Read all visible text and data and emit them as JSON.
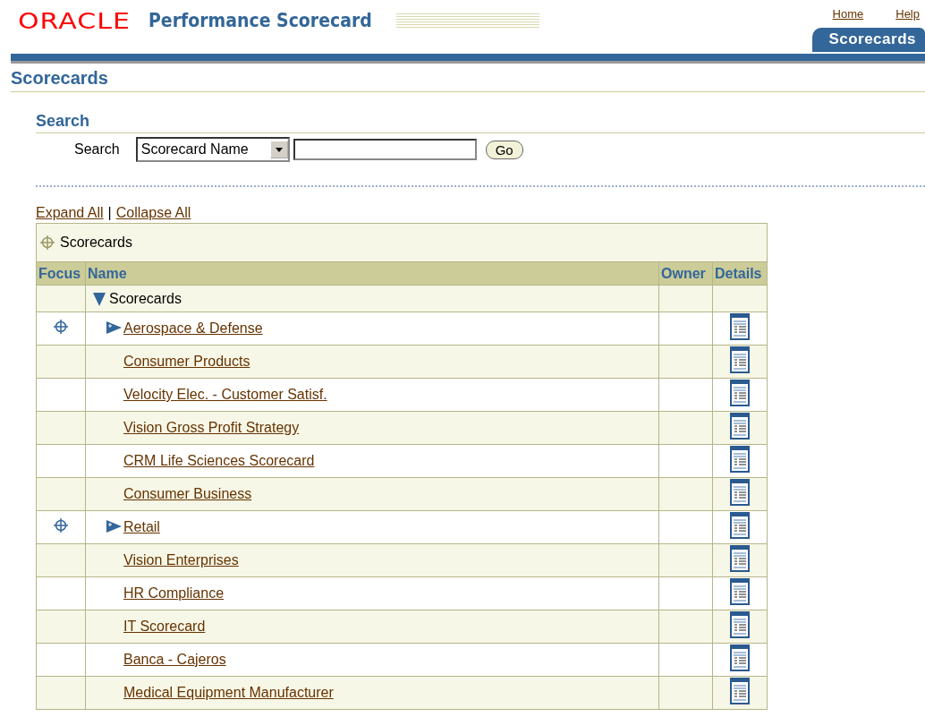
{
  "header": {
    "logo": "ORACLE",
    "product": "Performance Scorecard",
    "links": [
      "Home",
      "Help"
    ],
    "tabs": [
      {
        "label": "Scorecards",
        "selected": true
      }
    ]
  },
  "page_title": "Scorecards",
  "search": {
    "heading": "Search",
    "label": "Search",
    "select_value": "Scorecard Name",
    "button": "Go"
  },
  "tree_links": {
    "expand": "Expand All",
    "separator": "|",
    "collapse": "Collapse All"
  },
  "table": {
    "focus_caption": "Scorecards",
    "columns": [
      "Focus",
      "Name",
      "Owner",
      "Details"
    ],
    "root": {
      "name": "Scorecards",
      "expanded": true,
      "children": [
        {
          "name": "Aerospace & Defense",
          "focus": true,
          "expanded": false
        },
        {
          "name": "Consumer Products",
          "focus": false
        },
        {
          "name": "Velocity Elec. - Customer Satisf.",
          "focus": false
        },
        {
          "name": "Vision Gross Profit Strategy",
          "focus": false
        },
        {
          "name": "CRM Life Sciences Scorecard",
          "focus": false
        },
        {
          "name": "Consumer Business",
          "focus": false
        },
        {
          "name": "Retail",
          "focus": true,
          "expanded": false
        },
        {
          "name": "Vision Enterprises",
          "focus": false
        },
        {
          "name": "HR Compliance",
          "focus": false
        },
        {
          "name": "IT Scorecard",
          "focus": false
        },
        {
          "name": "Banca - Cajeros",
          "focus": false
        },
        {
          "name": "Medical Equipment Manufacturer",
          "focus": false
        }
      ]
    }
  }
}
